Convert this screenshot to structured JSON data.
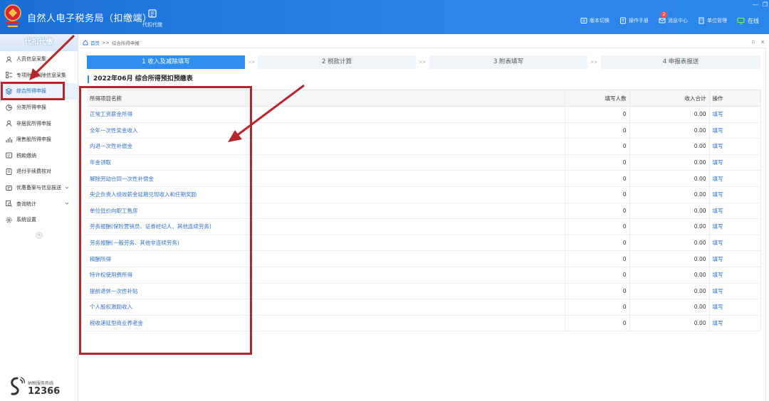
{
  "app": {
    "title": "自然人电子税务局（扣缴端）",
    "top_tool_label": "代扣代缴",
    "top_right": [
      {
        "label": "版本切换",
        "icon": "version-switch-icon"
      },
      {
        "label": "操作手册",
        "icon": "manual-icon"
      },
      {
        "label": "消息中心",
        "icon": "message-icon",
        "badge": "2"
      },
      {
        "label": "单位管理",
        "icon": "org-icon"
      }
    ],
    "status": "在线"
  },
  "sidebar": {
    "header": "代扣代缴",
    "items": [
      {
        "label": "人员信息采集",
        "icon": "person-icon"
      },
      {
        "label": "专项附加扣除信息采集",
        "icon": "grid-list-icon"
      },
      {
        "label": "综合所得申报",
        "icon": "layers-icon",
        "active": true
      },
      {
        "label": "分类所得申报",
        "icon": "pie-icon"
      },
      {
        "label": "非居民所得申报",
        "icon": "user-outline-icon"
      },
      {
        "label": "限售股所得申报",
        "icon": "bar-chart-icon"
      },
      {
        "label": "税款缴纳",
        "icon": "tax-pay-icon"
      },
      {
        "label": "退付手续费核对",
        "icon": "refund-icon"
      },
      {
        "label": "优惠备案与信息报送",
        "icon": "discount-icon",
        "expandable": true
      },
      {
        "label": "查询统计",
        "icon": "query-icon",
        "expandable": true
      },
      {
        "label": "系统设置",
        "icon": "settings-icon"
      }
    ],
    "collapse_glyph": "«",
    "hotline_label": "纳税服务热线",
    "hotline_number": "12366"
  },
  "breadcrumb": {
    "home": "首页",
    "separator": ">>",
    "current": "综合所得申报"
  },
  "steps": [
    {
      "label": "1 收入及减除填写",
      "active": true
    },
    {
      "label": "2 税款计算",
      "active": false
    },
    {
      "label": "3 附表填写",
      "active": false
    },
    {
      "label": "4 申报表报送",
      "active": false
    }
  ],
  "step_separator": ">>",
  "report_title": "2022年06月  综合所得预扣预缴表",
  "table": {
    "headers": [
      "所得项目名称",
      "填写人数",
      "收入合计",
      "操作"
    ],
    "rows": [
      {
        "name": "正常工资薪金所得",
        "count": "0",
        "total": "0.00",
        "op": "填写"
      },
      {
        "name": "全年一次性奖金收入",
        "count": "0",
        "total": "0.00",
        "op": "填写"
      },
      {
        "name": "内退一次性补偿金",
        "count": "0",
        "total": "0.00",
        "op": "填写"
      },
      {
        "name": "年金领取",
        "count": "0",
        "total": "0.00",
        "op": "填写"
      },
      {
        "name": "解除劳动合同一次性补偿金",
        "count": "0",
        "total": "0.00",
        "op": "填写"
      },
      {
        "name": "央企负责人绩效薪金延期兑现收入和任期奖励",
        "count": "0",
        "total": "0.00",
        "op": "填写"
      },
      {
        "name": "单位低价向职工售房",
        "count": "0",
        "total": "0.00",
        "op": "填写"
      },
      {
        "name": "劳务报酬(保险营销员、证券经纪人、其他连续劳务)",
        "count": "0",
        "total": "0.00",
        "op": "填写"
      },
      {
        "name": "劳务报酬(一般劳务、其他非连续劳务)",
        "count": "0",
        "total": "0.00",
        "op": "填写"
      },
      {
        "name": "稿酬所得",
        "count": "0",
        "total": "0.00",
        "op": "填写"
      },
      {
        "name": "特许权使用费所得",
        "count": "0",
        "total": "0.00",
        "op": "填写"
      },
      {
        "name": "提前退休一次性补贴",
        "count": "0",
        "total": "0.00",
        "op": "填写"
      },
      {
        "name": "个人股权激励收入",
        "count": "0",
        "total": "0.00",
        "op": "填写"
      },
      {
        "name": "税收递延型商业养老金",
        "count": "0",
        "total": "0.00",
        "op": "填写"
      }
    ]
  },
  "colors": {
    "title_bar": "#2b86ea",
    "accent": "#2e8ff0",
    "link": "#3571c8",
    "annotation": "#b3262b"
  }
}
